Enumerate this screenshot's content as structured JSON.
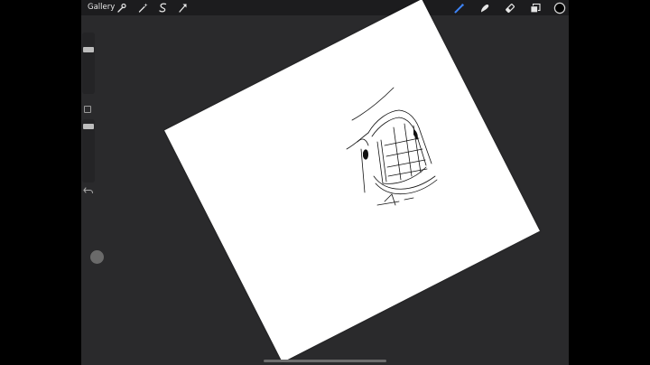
{
  "topbar": {
    "gallery_label": "Gallery",
    "left_tools": [
      "wrench-icon",
      "magic-wand-icon",
      "selection-icon",
      "transform-icon"
    ],
    "right_tools": [
      "brush-icon",
      "smudge-icon",
      "eraser-icon",
      "layers-icon",
      "color-swatch-icon"
    ]
  },
  "colors": {
    "accent": "#3d84f7",
    "background": "#2a2a2c",
    "topbar": "#1c1c1e",
    "canvas": "#ffffff",
    "current_color": "#000000"
  },
  "sidebar": {
    "controls": [
      "brush-size-slider",
      "modify-button",
      "opacity-slider",
      "undo-icon"
    ]
  }
}
